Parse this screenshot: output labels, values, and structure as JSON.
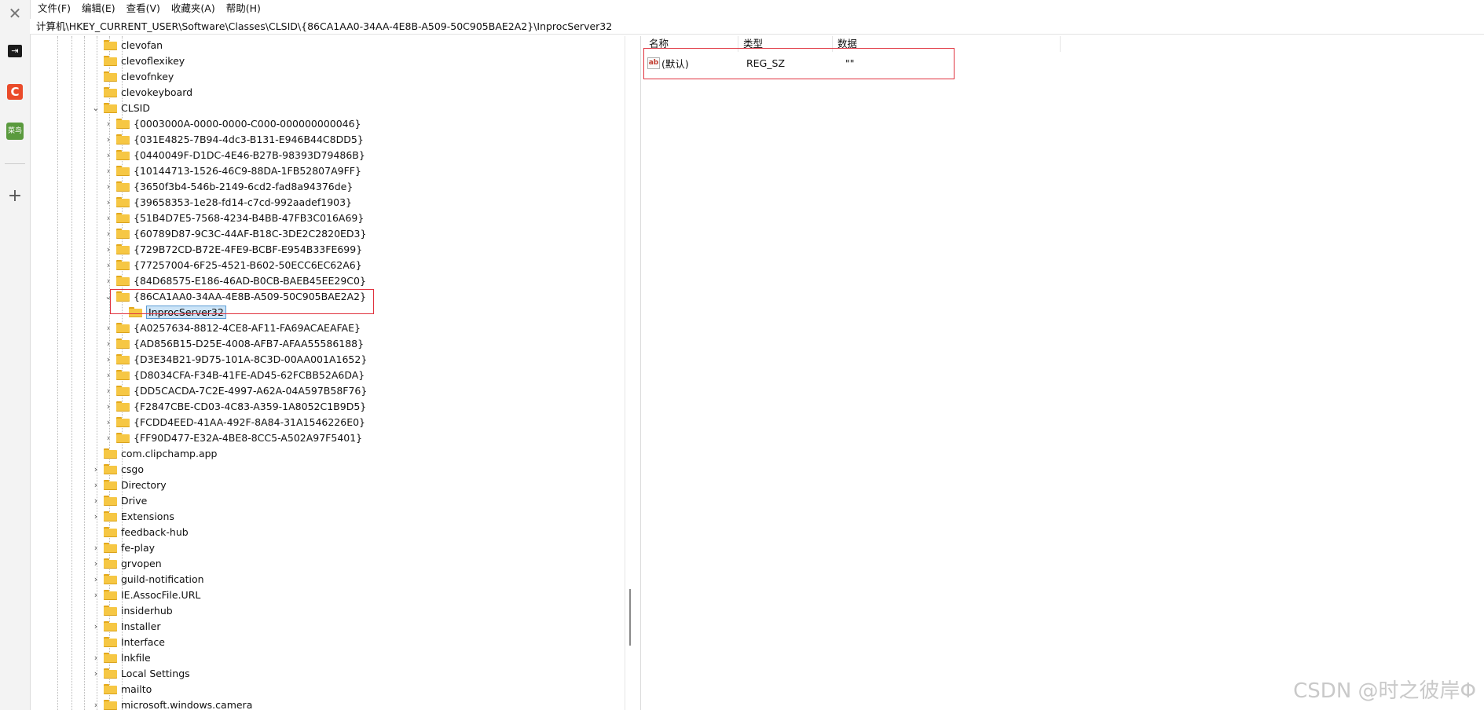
{
  "menu": [
    "文件(F)",
    "编辑(E)",
    "查看(V)",
    "收藏夹(A)",
    "帮助(H)"
  ],
  "address": "计算机\\HKEY_CURRENT_USER\\Software\\Classes\\CLSID\\{86CA1AA0-34AA-4E8B-A509-50C905BAE2A2}\\InprocServer32",
  "sidebar": {
    "icons": [
      "close-icon",
      "sign-in-icon",
      "csdn-note-icon",
      "runoob-icon",
      "add-icon"
    ],
    "runoob_label": "菜鸟",
    "csdn_label": "C"
  },
  "tree": [
    {
      "label": "clevofan",
      "level": 0,
      "chevron": ""
    },
    {
      "label": "clevoflexikey",
      "level": 0,
      "chevron": ""
    },
    {
      "label": "clevofnkey",
      "level": 0,
      "chevron": ""
    },
    {
      "label": "clevokeyboard",
      "level": 0,
      "chevron": ""
    },
    {
      "label": "CLSID",
      "level": 0,
      "chevron": "expanded"
    },
    {
      "label": "{0003000A-0000-0000-C000-000000000046}",
      "level": 1,
      "chevron": "collapsed"
    },
    {
      "label": "{031E4825-7B94-4dc3-B131-E946B44C8DD5}",
      "level": 1,
      "chevron": "collapsed"
    },
    {
      "label": "{0440049F-D1DC-4E46-B27B-98393D79486B}",
      "level": 1,
      "chevron": "collapsed"
    },
    {
      "label": "{10144713-1526-46C9-88DA-1FB52807A9FF}",
      "level": 1,
      "chevron": "collapsed"
    },
    {
      "label": "{3650f3b4-546b-2149-6cd2-fad8a94376de}",
      "level": 1,
      "chevron": "collapsed"
    },
    {
      "label": "{39658353-1e28-fd14-c7cd-992aadef1903}",
      "level": 1,
      "chevron": "collapsed"
    },
    {
      "label": "{51B4D7E5-7568-4234-B4BB-47FB3C016A69}",
      "level": 1,
      "chevron": "collapsed"
    },
    {
      "label": "{60789D87-9C3C-44AF-B18C-3DE2C2820ED3}",
      "level": 1,
      "chevron": "collapsed"
    },
    {
      "label": "{729B72CD-B72E-4FE9-BCBF-E954B33FE699}",
      "level": 1,
      "chevron": "collapsed"
    },
    {
      "label": "{77257004-6F25-4521-B602-50ECC6EC62A6}",
      "level": 1,
      "chevron": "collapsed"
    },
    {
      "label": "{84D68575-E186-46AD-B0CB-BAEB45EE29C0}",
      "level": 1,
      "chevron": "collapsed"
    },
    {
      "label": "{86CA1AA0-34AA-4E8B-A509-50C905BAE2A2}",
      "level": 1,
      "chevron": "expanded"
    },
    {
      "label": "InprocServer32",
      "level": 2,
      "chevron": "",
      "selected": true
    },
    {
      "label": "{A0257634-8812-4CE8-AF11-FA69ACAEAFAE}",
      "level": 1,
      "chevron": "collapsed"
    },
    {
      "label": "{AD856B15-D25E-4008-AFB7-AFAA55586188}",
      "level": 1,
      "chevron": "collapsed"
    },
    {
      "label": "{D3E34B21-9D75-101A-8C3D-00AA001A1652}",
      "level": 1,
      "chevron": "collapsed"
    },
    {
      "label": "{D8034CFA-F34B-41FE-AD45-62FCBB52A6DA}",
      "level": 1,
      "chevron": "collapsed"
    },
    {
      "label": "{DD5CACDA-7C2E-4997-A62A-04A597B58F76}",
      "level": 1,
      "chevron": "collapsed"
    },
    {
      "label": "{F2847CBE-CD03-4C83-A359-1A8052C1B9D5}",
      "level": 1,
      "chevron": "collapsed"
    },
    {
      "label": "{FCDD4EED-41AA-492F-8A84-31A1546226E0}",
      "level": 1,
      "chevron": "collapsed"
    },
    {
      "label": "{FF90D477-E32A-4BE8-8CC5-A502A97F5401}",
      "level": 1,
      "chevron": "collapsed"
    },
    {
      "label": "com.clipchamp.app",
      "level": 0,
      "chevron": ""
    },
    {
      "label": "csgo",
      "level": 0,
      "chevron": "collapsed"
    },
    {
      "label": "Directory",
      "level": 0,
      "chevron": "collapsed"
    },
    {
      "label": "Drive",
      "level": 0,
      "chevron": "collapsed"
    },
    {
      "label": "Extensions",
      "level": 0,
      "chevron": "collapsed"
    },
    {
      "label": "feedback-hub",
      "level": 0,
      "chevron": ""
    },
    {
      "label": "fe-play",
      "level": 0,
      "chevron": "collapsed"
    },
    {
      "label": "grvopen",
      "level": 0,
      "chevron": "collapsed"
    },
    {
      "label": "guild-notification",
      "level": 0,
      "chevron": "collapsed"
    },
    {
      "label": "IE.AssocFile.URL",
      "level": 0,
      "chevron": "collapsed"
    },
    {
      "label": "insiderhub",
      "level": 0,
      "chevron": ""
    },
    {
      "label": "Installer",
      "level": 0,
      "chevron": "collapsed"
    },
    {
      "label": "Interface",
      "level": 0,
      "chevron": ""
    },
    {
      "label": "lnkfile",
      "level": 0,
      "chevron": "collapsed"
    },
    {
      "label": "Local Settings",
      "level": 0,
      "chevron": "collapsed"
    },
    {
      "label": "mailto",
      "level": 0,
      "chevron": ""
    },
    {
      "label": "microsoft.windows.camera",
      "level": 0,
      "chevron": "collapsed"
    }
  ],
  "values_pane": {
    "columns": [
      "名称",
      "类型",
      "数据"
    ],
    "rows": [
      {
        "name": "(默认)",
        "type": "REG_SZ",
        "data": "\"\""
      }
    ]
  },
  "watermark": "CSDN @时之彼岸Φ",
  "colors": {
    "highlight": "#e0323e",
    "folder": "#f6c744",
    "selection": "#cce4f7"
  }
}
